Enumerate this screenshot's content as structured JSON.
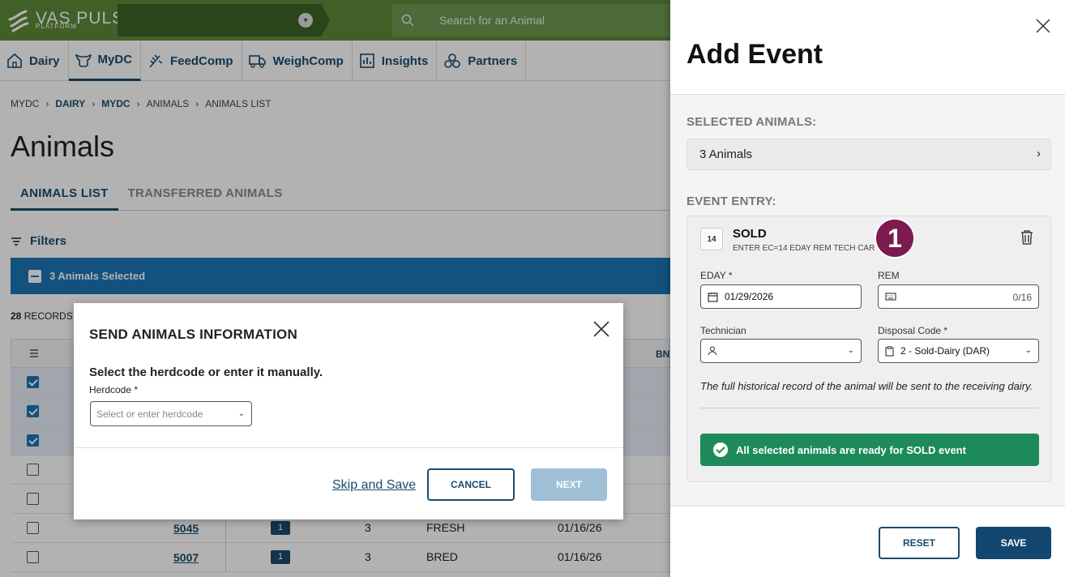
{
  "app": {
    "logo_text": "VAS PULSE",
    "logo_sub": "PLATFORM",
    "search_placeholder": "Search for an Animal"
  },
  "nav": [
    {
      "label": "Dairy",
      "icon": "home-icon"
    },
    {
      "label": "MyDC",
      "icon": "cow-icon"
    },
    {
      "label": "FeedComp",
      "icon": "feed-icon"
    },
    {
      "label": "WeighComp",
      "icon": "truck-icon"
    },
    {
      "label": "Insights",
      "icon": "chart-icon"
    },
    {
      "label": "Partners",
      "icon": "partners-icon"
    }
  ],
  "breadcrumb": [
    "MYDC",
    "DAIRY",
    "MYDC",
    "ANIMALS",
    "ANIMALS LIST"
  ],
  "page_title": "Animals",
  "tabs": [
    "ANIMALS LIST",
    "TRANSFERRED ANIMALS"
  ],
  "filters_label": "Filters",
  "selection_bar": "3 Animals Selected",
  "records_count": "28",
  "records_label": "RECORDS",
  "table": {
    "partial_header": "BN",
    "rows": [
      {
        "checked": true,
        "id": "",
        "lact": "",
        "status": "",
        "date": ""
      },
      {
        "checked": true,
        "id": "",
        "lact": "",
        "status": "",
        "date": ""
      },
      {
        "checked": true,
        "id": "",
        "lact": "",
        "status": "",
        "date": ""
      },
      {
        "checked": false,
        "id": "",
        "lact": "",
        "status": "",
        "date": ""
      },
      {
        "checked": false,
        "id": "",
        "lact": "",
        "status": "",
        "date": ""
      },
      {
        "checked": false,
        "id": "5045",
        "badge": "1",
        "lact": "3",
        "status": "FRESH",
        "date": "01/16/26"
      },
      {
        "checked": false,
        "id": "5007",
        "badge": "1",
        "lact": "3",
        "status": "BRED",
        "date": "01/16/26"
      }
    ]
  },
  "modal": {
    "title": "SEND ANIMALS INFORMATION",
    "subtitle": "Select the herdcode or enter it manually.",
    "field_label": "Herdcode *",
    "field_placeholder": "Select or enter herdcode",
    "skip_label": "Skip and Save",
    "cancel_label": "CANCEL",
    "next_label": "NEXT"
  },
  "panel": {
    "title": "Add Event",
    "selected_animals_heading": "SELECTED ANIMALS:",
    "selected_animals_value": "3 Animals",
    "event_entry_heading": "EVENT ENTRY:",
    "event_code": "14",
    "event_name": "SOLD",
    "event_desc": "ENTER EC=14 EDAY REM TECH CAR",
    "step_badge": "1",
    "eday_label": "EDAY *",
    "eday_value": "01/29/2026",
    "rem_label": "REM",
    "rem_counter": "0/16",
    "technician_label": "Technician",
    "disposal_label": "Disposal Code *",
    "disposal_value": "2 - Sold-Dairy (DAR)",
    "note": "The full historical record of the animal will be sent to the receiving dairy.",
    "ready_text": "All selected animals are ready for SOLD event",
    "reset_label": "RESET",
    "save_label": "SAVE"
  },
  "colors": {
    "brand_green": "#5e8a3a",
    "primary_blue": "#1a4b6e",
    "selection_blue": "#1c74b5",
    "success_green": "#1d8a5a",
    "step_badge": "#7b1b4f"
  }
}
